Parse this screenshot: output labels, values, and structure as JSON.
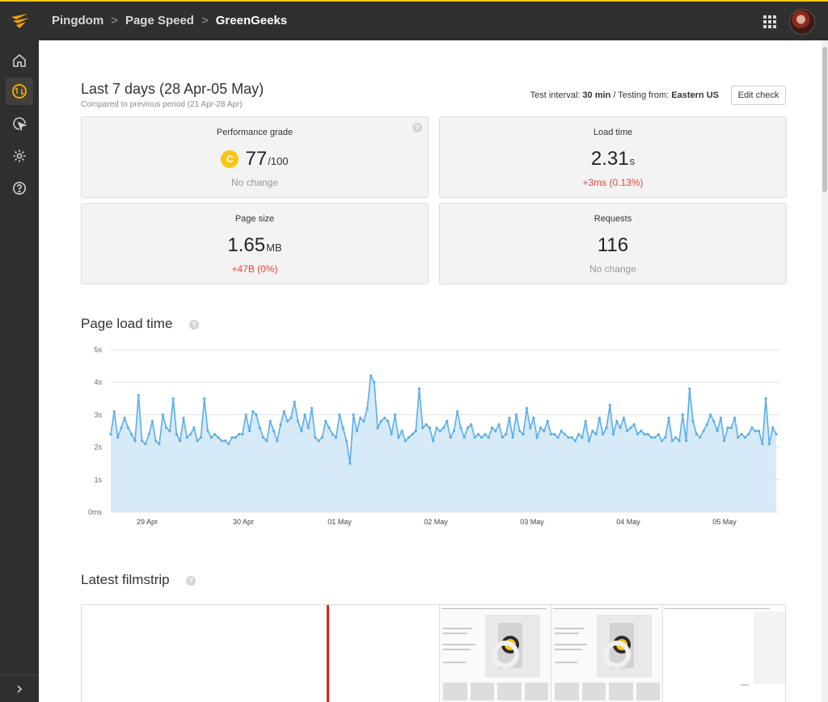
{
  "topbar": {
    "breadcrumbs": [
      "Pingdom",
      "Page Speed",
      "GreenGeeks"
    ],
    "separator": ">",
    "accent_color": "#f5c518"
  },
  "sidebar": {
    "items": [
      {
        "icon": "home-icon",
        "active": false
      },
      {
        "icon": "page-speed-icon",
        "active": true
      },
      {
        "icon": "cursor-monitor-icon",
        "active": false
      },
      {
        "icon": "gear-icon",
        "active": false
      },
      {
        "icon": "help-icon",
        "active": false
      }
    ],
    "expand_icon": "chevron-right-icon"
  },
  "header": {
    "title": "Last 7 days (28 Apr-05 May)",
    "subtitle": "Compared to previous period (21 Apr-28 Apr)",
    "test_interval_label": "Test interval:",
    "test_interval_value": "30 min",
    "testing_from_label": "/ Testing from:",
    "testing_from_value": "Eastern US",
    "edit_button": "Edit check"
  },
  "cards": {
    "grade": {
      "title": "Performance grade",
      "badge": "C",
      "value": "77",
      "unit": "/100",
      "change": "No change"
    },
    "load": {
      "title": "Load time",
      "value": "2.31",
      "unit": "s",
      "change": "+3ms (0.13%)"
    },
    "size": {
      "title": "Page size",
      "value": "1.65",
      "unit": "MB",
      "change": "+47B (0%)"
    },
    "requests": {
      "title": "Requests",
      "value": "116",
      "change": "No change"
    },
    "help_glyph": "?"
  },
  "load_section": {
    "title": "Page load time"
  },
  "filmstrip_section": {
    "title": "Latest filmstrip"
  },
  "chart_data": {
    "type": "area",
    "title": "Page load time",
    "y_ticks": [
      "0ms",
      "1s",
      "2s",
      "3s",
      "4s",
      "5s"
    ],
    "x_ticks": [
      "29 Apr",
      "30 Apr",
      "01 May",
      "02 May",
      "03 May",
      "04 May",
      "05 May"
    ],
    "ylim": [
      0,
      5
    ],
    "grid": true,
    "line_color": "#5aaee8",
    "fill_color": "#d6eaf8",
    "values": [
      2.4,
      3.1,
      2.3,
      2.6,
      2.9,
      2.6,
      2.4,
      2.2,
      3.6,
      2.2,
      2.1,
      2.4,
      2.8,
      2.2,
      2.1,
      3.0,
      2.6,
      2.5,
      3.5,
      2.4,
      2.2,
      2.9,
      2.3,
      2.4,
      2.6,
      2.2,
      2.3,
      3.5,
      2.5,
      2.3,
      2.4,
      2.3,
      2.2,
      2.2,
      2.1,
      2.3,
      2.3,
      2.4,
      2.4,
      3.0,
      2.5,
      3.1,
      3.0,
      2.6,
      2.3,
      2.2,
      2.8,
      2.5,
      2.2,
      2.7,
      3.1,
      2.8,
      2.9,
      3.4,
      2.8,
      2.5,
      3.0,
      2.6,
      3.2,
      2.3,
      2.2,
      2.3,
      2.8,
      2.6,
      2.4,
      2.3,
      3.0,
      2.6,
      2.2,
      1.5,
      3.0,
      2.5,
      2.9,
      2.8,
      3.2,
      4.2,
      4.0,
      2.6,
      2.8,
      2.9,
      2.8,
      2.4,
      3.0,
      2.3,
      2.5,
      2.2,
      2.3,
      2.4,
      2.5,
      3.8,
      2.6,
      2.7,
      2.6,
      2.2,
      2.6,
      2.5,
      2.6,
      2.8,
      2.3,
      2.5,
      3.1,
      2.6,
      2.3,
      2.6,
      2.7,
      2.3,
      2.4,
      2.3,
      2.4,
      2.3,
      2.6,
      2.5,
      2.7,
      2.3,
      2.4,
      2.9,
      2.3,
      3.0,
      2.5,
      2.4,
      3.2,
      2.6,
      2.9,
      2.3,
      2.6,
      2.5,
      2.8,
      2.4,
      2.4,
      2.3,
      2.5,
      2.4,
      2.3,
      2.3,
      2.2,
      2.4,
      2.3,
      2.8,
      2.2,
      2.5,
      2.4,
      2.9,
      2.4,
      2.6,
      3.3,
      2.4,
      2.8,
      2.6,
      2.9,
      2.5,
      2.6,
      2.7,
      2.4,
      2.5,
      2.4,
      2.4,
      2.3,
      2.3,
      2.4,
      2.2,
      2.3,
      2.9,
      2.2,
      2.3,
      2.2,
      3.0,
      2.2,
      3.8,
      2.8,
      2.4,
      2.3,
      2.5,
      2.7,
      3.0,
      2.8,
      2.5,
      2.9,
      2.2,
      2.6,
      2.6,
      2.9,
      2.3,
      2.4,
      2.3,
      2.4,
      2.6,
      2.5,
      2.5,
      2.1,
      3.5,
      2.1,
      2.6,
      2.4
    ]
  }
}
